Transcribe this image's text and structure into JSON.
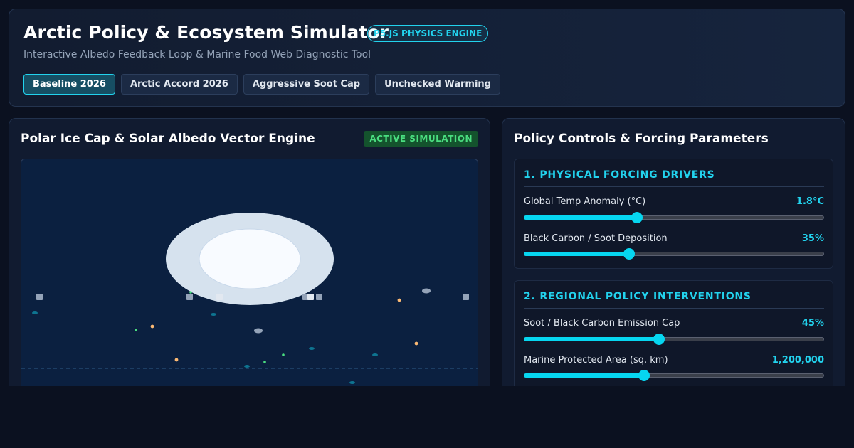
{
  "header": {
    "title": "Arctic Policy & Ecosystem Simulator",
    "engine_badge": "P5.JS PHYSICS ENGINE",
    "subtitle": "Interactive Albedo Feedback Loop & Marine Food Web Diagnostic Tool",
    "scenarios": [
      {
        "label": "Baseline 2026",
        "active": true
      },
      {
        "label": "Arctic Accord 2026",
        "active": false
      },
      {
        "label": "Aggressive Soot Cap",
        "active": false
      },
      {
        "label": "Unchecked Warming",
        "active": false
      }
    ]
  },
  "simulation": {
    "title": "Polar Ice Cap & Solar Albedo Vector Engine",
    "status_badge": "ACTIVE SIMULATION"
  },
  "controls": {
    "title": "Policy Controls & Forcing Parameters",
    "section_1": {
      "title": "1. PHYSICAL FORCING DRIVERS",
      "temp_label": "Global Temp Anomaly (°C)",
      "temp_value": "1.8°C",
      "temp_fraction": 0.376,
      "soot_label": "Black Carbon / Soot Deposition",
      "soot_value": "35%",
      "soot_fraction": 0.35
    },
    "section_2": {
      "title": "2. REGIONAL POLICY INTERVENTIONS",
      "cap_label": "Soot / Black Carbon Emission Cap",
      "cap_value": "45%",
      "cap_fraction": 0.45,
      "mpa_label": "Marine Protected Area (sq. km)",
      "mpa_value": "1,200,000",
      "mpa_fraction": 0.4
    }
  },
  "colors": {
    "accent": "#22d3ee",
    "active_green": "#4ade80",
    "ice": "#d6e2ee",
    "ice_core": "#f8fbff",
    "ocean": "#0b2040"
  }
}
